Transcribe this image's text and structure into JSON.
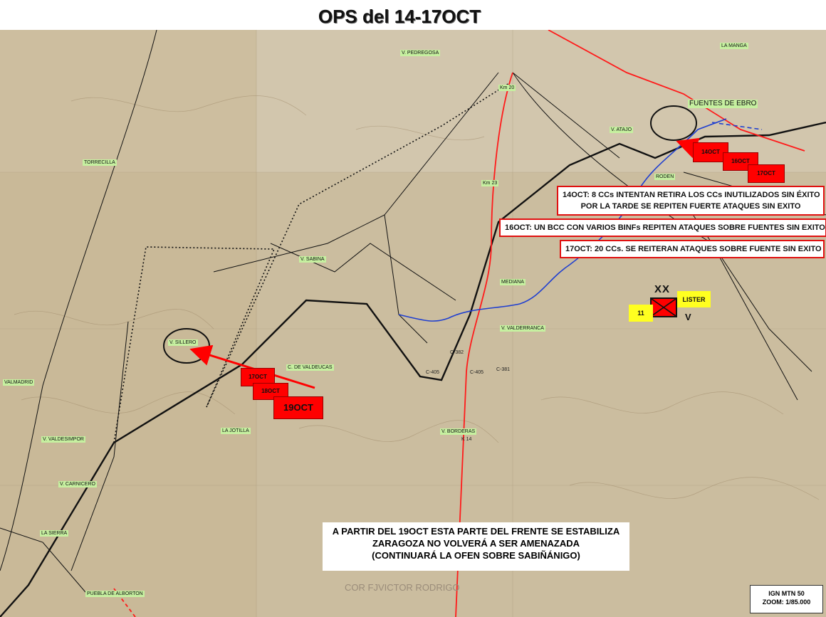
{
  "title": "OPS del 14-17OCT",
  "places": {
    "pedregosa": "V. PEDREGOSA",
    "la_manga": "LA MANGA",
    "fuentes": "FUENTES DE EBRO",
    "km20": "Km 20",
    "atajo": "V. ATAJO",
    "torrecilla": "TORRECILLA",
    "roden": "RODEN",
    "km23": "Km 23",
    "sabina": "V. SABINA",
    "mediana": "MEDIANA",
    "sillero": "V. SILLERO",
    "valdelucas": "C. DE VALDEUCAS",
    "valderranca": "V. VALDERRANCA",
    "c382": "C-382",
    "c405a": "C-405",
    "c405b": "C-405",
    "c381": "C-381",
    "valmadrid": "VALMADRID",
    "la_jotilla": "LA JOTILLA",
    "valdesimpor": "V. VALDESIMPOR",
    "borderas": "V. BORDERAS",
    "km14": "K 14",
    "carnicero": "V. CARNICERO",
    "la_sierra": "LA SIERRA",
    "puebla": "PUEBLA DE ALBORTON"
  },
  "attacks_east": {
    "d1": "14OCT",
    "d2": "16OCT",
    "d3": "17OCT"
  },
  "attacks_west": {
    "d1": "17OCT",
    "d2": "18OCT",
    "d3": "19OCT"
  },
  "boxes": {
    "b14_line1": "14OCT: 8 CCs INTENTAN RETIRA LOS CCs INUTILIZADOS SIN ÉXITO",
    "b14_line2": "POR LA TARDE SE REPITEN FUERTE ATAQUES SIN EXITO",
    "b16": "16OCT: UN BCC CON VARIOS BINFs REPITEN ATAQUES SOBRE FUENTES SIN EXITO",
    "b17": "17OCT: 20 CCs. SE REITERAN ATAQUES SOBRE FUENTE SIN EXITO"
  },
  "unit": {
    "name": "LISTER",
    "number": "11",
    "size": "V",
    "echelon": "XX"
  },
  "note": {
    "line1": "A PARTIR DEL 19OCT ESTA PARTE DEL FRENTE SE ESTABILIZA",
    "line2": "ZARAGOZA NO VOLVERÁ A SER AMENAZADA",
    "line3": "(CONTINUARÁ LA OFEN SOBRE SABIÑÁNIGO)"
  },
  "credit": "COR FJVICTOR RODRIGO",
  "ign": {
    "line1": "IGN MTN 50",
    "line2": "ZOOM: 1/85.000"
  },
  "colors": {
    "terrain": "#c9b899",
    "front_line": "#e01010",
    "river": "#1f3fd0",
    "label_bg": "#c6f0a0"
  }
}
